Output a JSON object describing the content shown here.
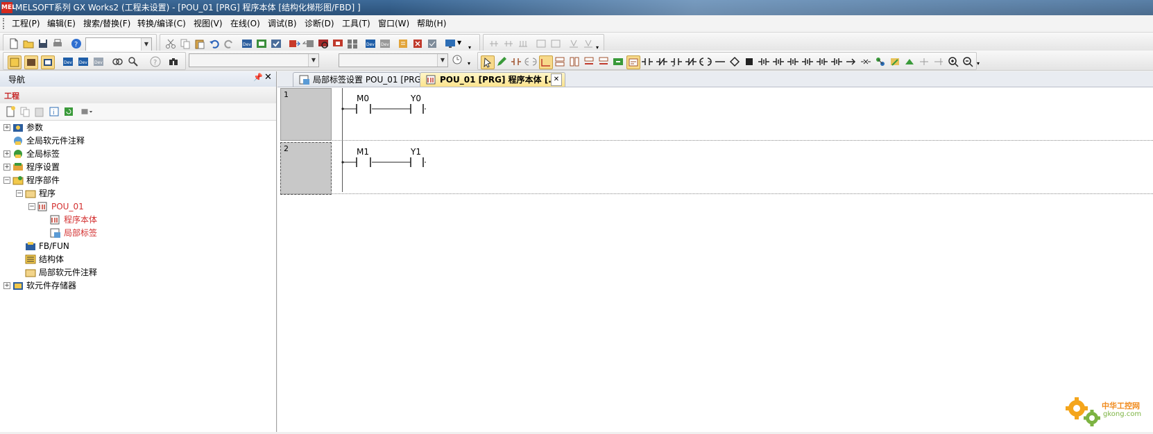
{
  "window": {
    "title": "MELSOFT系列 GX Works2 (工程未设置) - [POU_01 [PRG] 程序本体 [结构化梯形图/FBD] ]",
    "app_icon": "mel-icon"
  },
  "menu": [
    "工程(P)",
    "编辑(E)",
    "搜索/替换(F)",
    "转换/编译(C)",
    "视图(V)",
    "在线(O)",
    "调试(B)",
    "诊断(D)",
    "工具(T)",
    "窗口(W)",
    "帮助(H)"
  ],
  "navigation": {
    "header": "导航",
    "pin_glyph": "📌",
    "close_glyph": "✕",
    "section": "工程",
    "tree": [
      {
        "label": "参数",
        "level": 0,
        "expander": "+",
        "icon": "parameter-icon",
        "red": false
      },
      {
        "label": "全局软元件注释",
        "level": 0,
        "expander": "",
        "icon": "global-comment-icon",
        "red": false
      },
      {
        "label": "全局标签",
        "level": 0,
        "expander": "+",
        "icon": "global-label-icon",
        "red": false
      },
      {
        "label": "程序设置",
        "level": 0,
        "expander": "+",
        "icon": "program-setting-icon",
        "red": false
      },
      {
        "label": "程序部件",
        "level": 0,
        "expander": "−",
        "icon": "program-parts-icon",
        "red": false
      },
      {
        "label": "程序",
        "level": 1,
        "expander": "−",
        "icon": "program-folder-icon",
        "red": false
      },
      {
        "label": "POU_01",
        "level": 2,
        "expander": "−",
        "icon": "pou-icon",
        "red": true
      },
      {
        "label": "程序本体",
        "level": 3,
        "expander": "",
        "icon": "program-body-icon",
        "red": true
      },
      {
        "label": "局部标签",
        "level": 3,
        "expander": "",
        "icon": "local-label-icon",
        "red": true
      },
      {
        "label": "FB/FUN",
        "level": 1,
        "expander": "",
        "icon": "fb-fun-icon",
        "red": false
      },
      {
        "label": "结构体",
        "level": 1,
        "expander": "",
        "icon": "structure-icon",
        "red": false
      },
      {
        "label": "局部软元件注释",
        "level": 1,
        "expander": "",
        "icon": "local-comment-icon",
        "red": false
      },
      {
        "label": "软元件存储器",
        "level": 0,
        "expander": "+",
        "icon": "device-memory-icon",
        "red": false
      }
    ]
  },
  "tabs": [
    {
      "label": "局部标签设置 POU_01 [PRG]",
      "active": false
    },
    {
      "label": "POU_01 [PRG] 程序本体 [...",
      "active": true,
      "close_glyph": "✕"
    }
  ],
  "ladder": {
    "rungs": [
      {
        "number": "1",
        "contact": "M0",
        "coil": "Y0"
      },
      {
        "number": "2",
        "contact": "M1",
        "coil": "Y1"
      }
    ]
  },
  "watermark": {
    "line1": "中华工控网",
    "line2": "gkong.com"
  },
  "colors": {
    "title_bar": "#2b5179",
    "tree_highlight": "#d32f2f",
    "rung_gutter": "#c8c8c8"
  }
}
